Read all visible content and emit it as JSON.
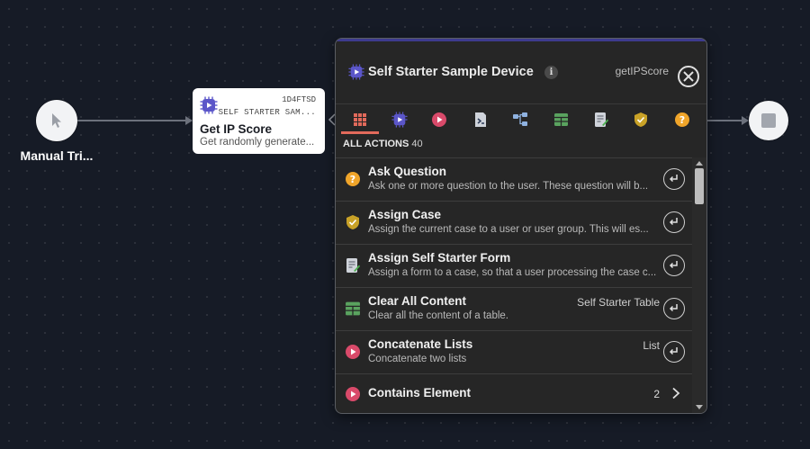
{
  "canvas": {
    "trigger_label": "Manual Tri...",
    "node": {
      "id_code": "1D4FTSD",
      "vendor": "SELF STARTER SAM...",
      "title": "Get IP Score",
      "description": "Get randomly generate..."
    }
  },
  "panel": {
    "title": "Self Starter Sample Device",
    "info_glyph": "i",
    "action_id": "getIPScore",
    "tabs": [
      "all-actions-grid-icon",
      "device-chip-icon",
      "list-icon",
      "code-icon",
      "workflow-icon",
      "table-icon",
      "form-icon",
      "shield-icon",
      "question-icon"
    ],
    "count_label": "ALL ACTIONS",
    "count": "40",
    "items": [
      {
        "title": "Ask Question",
        "desc": "Ask one or more question to the user. These question will b...",
        "tag": ""
      },
      {
        "title": "Assign Case",
        "desc": "Assign the current case to a user or user group. This will es...",
        "tag": ""
      },
      {
        "title": "Assign Self Starter Form",
        "desc": "Assign a form to a case, so that a user processing the case c...",
        "tag": ""
      },
      {
        "title": "Clear All Content",
        "desc": "Clear all the content of a table.",
        "tag": "Self Starter Table"
      },
      {
        "title": "Concatenate Lists",
        "desc": "Concatenate two lists",
        "tag": "List"
      },
      {
        "title": "Contains Element",
        "desc": "",
        "tag": "",
        "count": "2"
      }
    ]
  },
  "colors": {
    "accent_underline": "#e26a5b",
    "panel_topbar": "#3d3b8e",
    "list_icon": "#d94a6a",
    "question_icon": "#f0a52a",
    "table_icon": "#5aa35f"
  }
}
